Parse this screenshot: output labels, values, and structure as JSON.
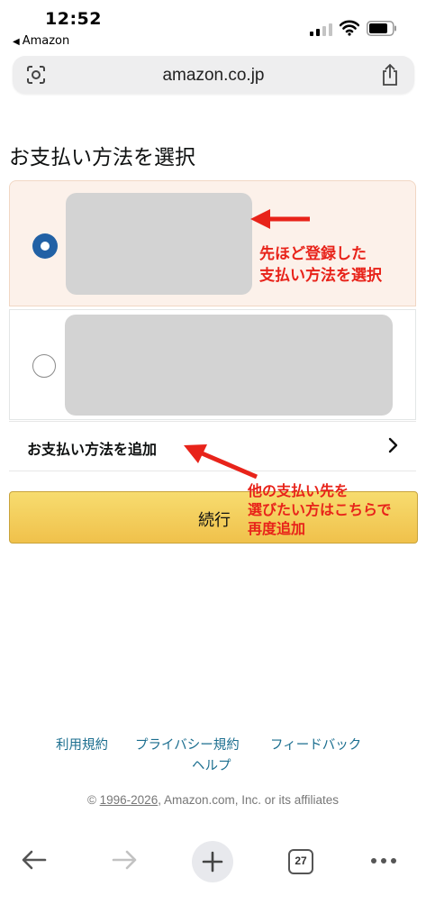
{
  "status_bar": {
    "time": "12:52",
    "back_app": "Amazon",
    "icons": [
      "cellular-signal-icon",
      "wifi-icon",
      "battery-icon"
    ]
  },
  "browser": {
    "url": "amazon.co.jp",
    "icons": [
      "lens-icon",
      "share-icon"
    ]
  },
  "page": {
    "title": "お支払い方法を選択",
    "payment_options": [
      {
        "selected": true
      },
      {
        "selected": false
      }
    ],
    "add_payment_label": "お支払い方法を追加",
    "continue_label": "続行"
  },
  "annotations": {
    "note1_line1": "先ほど登録した",
    "note1_line2": "支払い方法を選択",
    "note2_line1": "他の支払い先を",
    "note2_line2": "選びたい方はこちらで",
    "note2_line3": "再度追加",
    "color": "#e8231a"
  },
  "footer": {
    "links": [
      "利用規約",
      "プライバシー規約",
      "フィードバック",
      "ヘルプ"
    ],
    "copyright_prefix": "© ",
    "copyright_years": "1996-2026",
    "copyright_suffix": ", Amazon.com, Inc. or its affiliates"
  },
  "toolbar": {
    "tab_count": "27",
    "icons": [
      "back-arrow-icon",
      "forward-arrow-icon",
      "new-tab-plus-icon",
      "tabs-icon",
      "more-icon"
    ]
  },
  "colors": {
    "selected_bg": "#fcf1ea",
    "radio_selected": "#2161a5",
    "continue_button": "#f0c14b",
    "link": "#1b6e8f"
  }
}
